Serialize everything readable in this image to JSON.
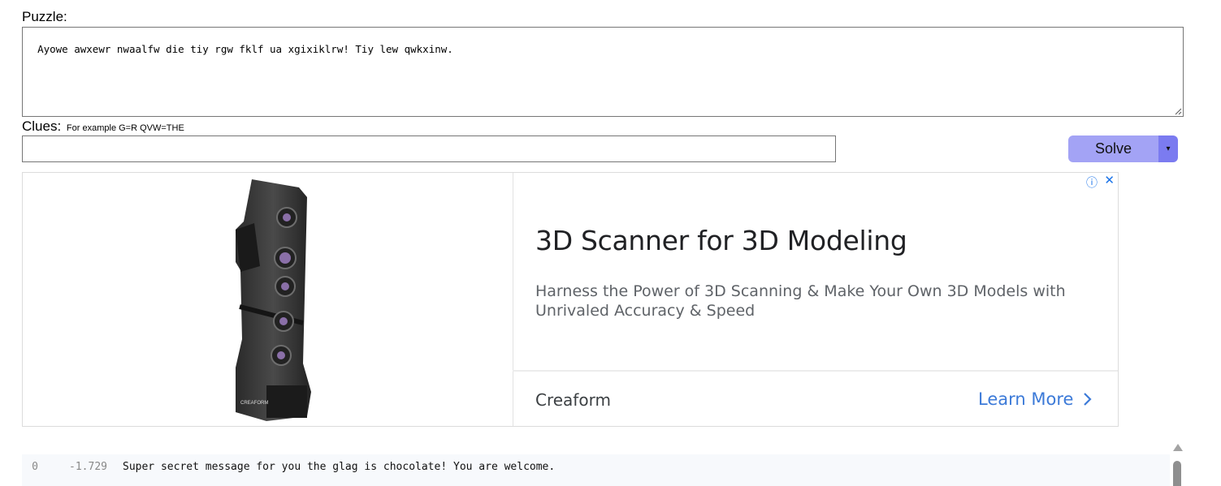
{
  "puzzle": {
    "label": "Puzzle:",
    "text": "Ayowe awxewr nwaalfw die tiy rgw fklf ua xgixiklrw! Tiy lew qwkxinw."
  },
  "clues": {
    "label": "Clues:",
    "example": "For example G=R QVW=THE",
    "value": ""
  },
  "solve": {
    "label": "Solve",
    "dropdown_glyph": "▾"
  },
  "ad": {
    "info_glyph": "ⓘ",
    "close_glyph": "✕",
    "headline": "3D Scanner for 3D Modeling",
    "description": "Harness the Power of 3D Scanning & Make Your Own 3D Models with Unrivaled Accuracy & Speed",
    "advertiser": "Creaform",
    "cta": "Learn More",
    "cta_icon": "chevron-right-icon",
    "product_logo": "CREAFORM"
  },
  "results": [
    {
      "index": "0",
      "score": "-1.729",
      "text": "Super secret message for you the glag is chocolate! You are welcome."
    }
  ]
}
